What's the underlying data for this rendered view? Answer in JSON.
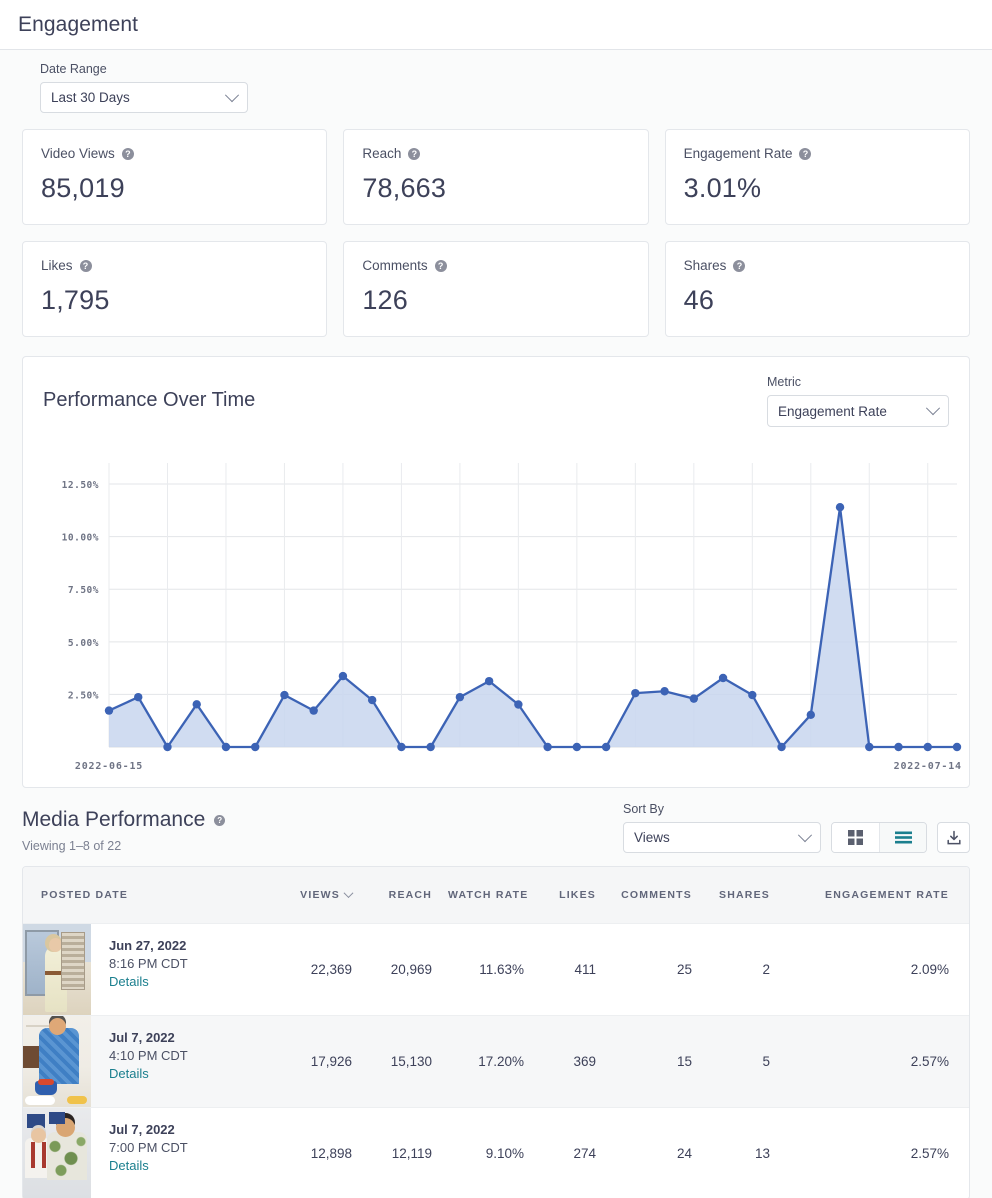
{
  "header": {
    "title": "Engagement"
  },
  "filters": {
    "date_range": {
      "label": "Date Range",
      "value": "Last 30 Days"
    }
  },
  "kpis": [
    {
      "label": "Video Views",
      "value": "85,019",
      "help": "?"
    },
    {
      "label": "Reach",
      "value": "78,663",
      "help": "?"
    },
    {
      "label": "Engagement Rate",
      "value": "3.01%",
      "help": "?"
    },
    {
      "label": "Likes",
      "value": "1,795",
      "help": "?"
    },
    {
      "label": "Comments",
      "value": "126",
      "help": "?"
    },
    {
      "label": "Shares",
      "value": "46",
      "help": "?"
    }
  ],
  "chart_panel": {
    "title": "Performance Over Time",
    "metric": {
      "label": "Metric",
      "value": "Engagement Rate"
    }
  },
  "chart_data": {
    "type": "area",
    "title": "Performance Over Time",
    "xlabel": "",
    "ylabel": "Engagement Rate",
    "ylim": [
      0,
      13.5
    ],
    "grid": true,
    "legend": false,
    "line_color": "#3c63b5",
    "fill_color": "#c8d6ef",
    "y_ticks": [
      "2.50%",
      "5.00%",
      "7.50%",
      "10.00%",
      "12.50%"
    ],
    "y_tick_values": [
      2.5,
      5.0,
      7.5,
      10.0,
      12.5
    ],
    "x_tick_labels": [
      "2022-06-15",
      "2022-07-14"
    ],
    "x": [
      "2022-06-15",
      "2022-06-16",
      "2022-06-17",
      "2022-06-18",
      "2022-06-19",
      "2022-06-20",
      "2022-06-21",
      "2022-06-22",
      "2022-06-23",
      "2022-06-24",
      "2022-06-25",
      "2022-06-26",
      "2022-06-27",
      "2022-06-28",
      "2022-06-29",
      "2022-06-30",
      "2022-07-01",
      "2022-07-02",
      "2022-07-03",
      "2022-07-04",
      "2022-07-05",
      "2022-07-06",
      "2022-07-07",
      "2022-07-08",
      "2022-07-09",
      "2022-07-10",
      "2022-07-11",
      "2022-07-12",
      "2022-07-13",
      "2022-07-14"
    ],
    "values": [
      1.73,
      2.37,
      0.0,
      2.03,
      0.0,
      0.0,
      2.47,
      1.73,
      3.37,
      2.23,
      0.0,
      0.0,
      2.37,
      3.13,
      2.02,
      0.0,
      0.0,
      0.0,
      2.56,
      2.65,
      2.3,
      3.28,
      2.47,
      0.0,
      1.53,
      11.4,
      0.0,
      0.0,
      0.0,
      0.0
    ]
  },
  "media": {
    "title": "Media Performance",
    "help": "?",
    "viewing": "Viewing 1–8 of 22",
    "sort_by": {
      "label": "Sort By",
      "value": "Views"
    },
    "view_grid_icon": "grid-view-icon",
    "view_list_icon": "list-view-icon",
    "download_icon": "download-icon",
    "columns": [
      "POSTED DATE",
      "VIEWS",
      "REACH",
      "WATCH RATE",
      "LIKES",
      "COMMENTS",
      "SHARES",
      "ENGAGEMENT RATE"
    ],
    "sorted_column": "VIEWS",
    "details_label": "Details",
    "rows": [
      {
        "date": "Jun 27, 2022",
        "time": "8:16 PM CDT",
        "views": "22,369",
        "reach": "20,969",
        "watch_rate": "11.63%",
        "likes": "411",
        "comments": "25",
        "shares": "2",
        "engagement_rate": "2.09%",
        "thumb": "woman-in-room-thumbnail"
      },
      {
        "date": "Jul 7, 2022",
        "time": "4:10 PM CDT",
        "views": "17,926",
        "reach": "15,130",
        "watch_rate": "17.20%",
        "likes": "369",
        "comments": "15",
        "shares": "5",
        "engagement_rate": "2.57%",
        "thumb": "man-cooking-thumbnail"
      },
      {
        "date": "Jul 7, 2022",
        "time": "7:00 PM CDT",
        "views": "12,898",
        "reach": "12,119",
        "watch_rate": "9.10%",
        "likes": "274",
        "comments": "24",
        "shares": "13",
        "engagement_rate": "2.57%",
        "thumb": "two-men-thumbnail"
      }
    ]
  },
  "colors": {
    "accent_teal": "#1b7f8e",
    "chart_line": "#3c63b5",
    "chart_fill": "#c8d6ef",
    "text_primary": "#3d4159",
    "text_muted": "#7b8091"
  }
}
